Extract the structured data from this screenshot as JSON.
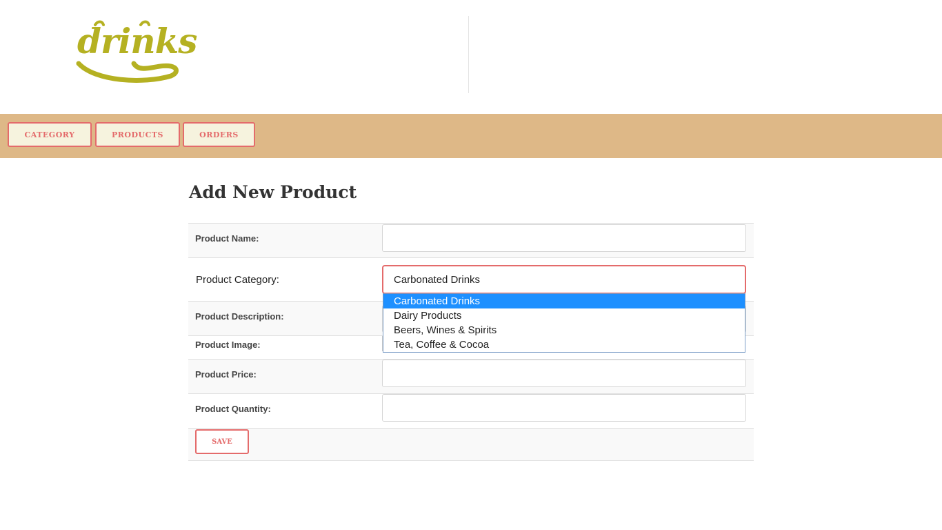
{
  "brand": {
    "logo_text": "drinks",
    "logo_color": "#b5b122"
  },
  "colors": {
    "nav_bg": "#deb887",
    "accent": "#e46b6b",
    "nav_btn_bg": "#f6f3de",
    "option_highlight": "#1e90ff"
  },
  "nav": [
    {
      "label": "CATEGORY"
    },
    {
      "label": "PRODUCTS"
    },
    {
      "label": "ORDERS"
    }
  ],
  "page_title": "Add New Product",
  "form": {
    "name_label": "Product Name:",
    "name_value": "",
    "category_label": "Product Category:",
    "category_selected": "Carbonated Drinks",
    "category_options": [
      "Carbonated Drinks",
      "Dairy Products",
      "Beers, Wines & Spirits",
      "Tea, Coffee & Cocoa"
    ],
    "description_label": "Product Description:",
    "image_label": "Product Image:",
    "price_label": "Product Price:",
    "price_value": "",
    "quantity_label": "Product Quantity:",
    "quantity_value": "",
    "save_label": "SAVE"
  }
}
